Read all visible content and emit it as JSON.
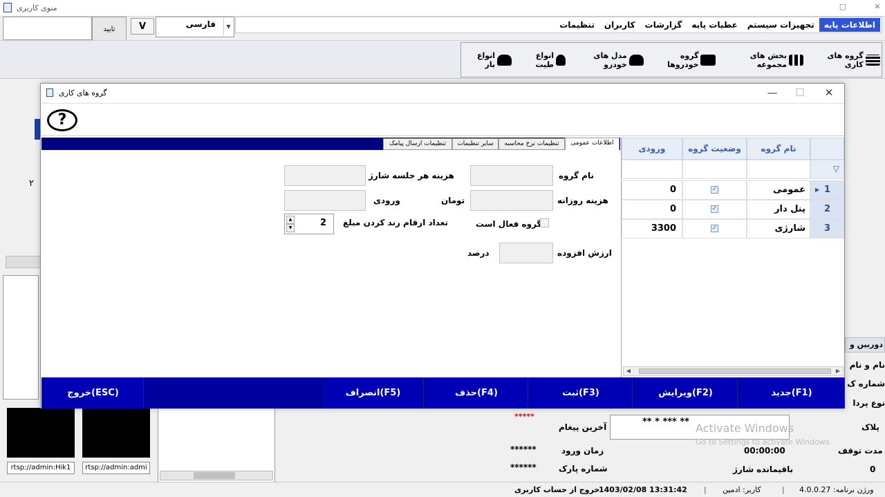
{
  "app": {
    "title": "منوی کاربری"
  },
  "menu": [
    "اطلاعات پایه",
    "تجهیزات سیستم",
    "عطیات پایه",
    "گزارشات",
    "کاربران",
    "تنظیمات"
  ],
  "topbar": {
    "confirm_label": "تایید",
    "v_label": "V",
    "language_value": "فارسی"
  },
  "toolbar": [
    {
      "label": "گروه های کاری",
      "icon": "list-icon"
    },
    {
      "label": "بخش های مجموعه",
      "icon": "grid-icon"
    },
    {
      "label": "گروه خودروها",
      "icon": "vehicles-icon"
    },
    {
      "label": "مدل های خودرو",
      "icon": "car-icon"
    },
    {
      "label": "انواع طیت",
      "icon": "person-icon"
    },
    {
      "label": "انواع بار",
      "icon": "truck-icon"
    }
  ],
  "background": {
    "left_text_1": "۲",
    "cameras": [
      "rtsp://admin:Hik1",
      "rtsp://admin:admi"
    ],
    "red_stars": "*****",
    "plate": "**    *    ***    **",
    "last_message_label": "آخرین پیغام",
    "entry_time_label": "زمان ورود",
    "entry_time_value": "******",
    "park_number_label": "شماره پارک",
    "park_number_value": "******",
    "plate_label": "پلاک",
    "stop_duration_label": "مدت توقف",
    "stop_duration_value": "00:00:00",
    "remaining_charge_label": "باقیمانده شارژ",
    "remaining_charge_value": "0",
    "camera_section_label": "دوربین و",
    "right_labels": [
      "نام و نام",
      "شماره ک",
      "نوع پردا"
    ],
    "watermark_title": "Activate Windows",
    "watermark_sub": "Go to Settings to activate Windows."
  },
  "status": {
    "version": "ورژن برنامه: 4.0.0.27",
    "user": "کاربر: ادمین",
    "datetime": "1403/02/08   13:31:42",
    "logout": "خروج از حساب کاربری"
  },
  "dialog": {
    "title": "گروه های کاری",
    "help": "?",
    "tabs": [
      "اطلاعات عمومی",
      "تنظیمات نرخ محاسبه",
      "سایر تنظیمات",
      "تنظیمات ارسال پیامک"
    ],
    "form": {
      "group_name_label": "نام گروه",
      "charge_session_cost_label": "هزینه هر جلسه شارژ",
      "daily_cost_label": "هزینه روزانه",
      "toman_label": "تومان",
      "entry_label": "ورودی",
      "active_label": "گروه فعال است",
      "rounding_digits_label": "تعداد ارقام رند کردن مبلغ",
      "rounding_digits_value": "2",
      "vat_label": "ارزش افزوده",
      "percent_label": "درصد"
    },
    "grid": {
      "columns": [
        "نام گروه",
        "وضعیت گروه",
        "ورودی"
      ],
      "rows": [
        {
          "n": "1",
          "name": "عمومی",
          "active": true,
          "entry": "0"
        },
        {
          "n": "2",
          "name": "پنل دار",
          "active": true,
          "entry": "0"
        },
        {
          "n": "3",
          "name": "شارژی",
          "active": true,
          "entry": "3300"
        }
      ]
    },
    "actions": [
      "جدید(F1)",
      "ویرایش(F2)",
      "ثبت(F3)",
      "حذف(F4)",
      "انصراف(F5)",
      "خروج(ESC)"
    ]
  }
}
